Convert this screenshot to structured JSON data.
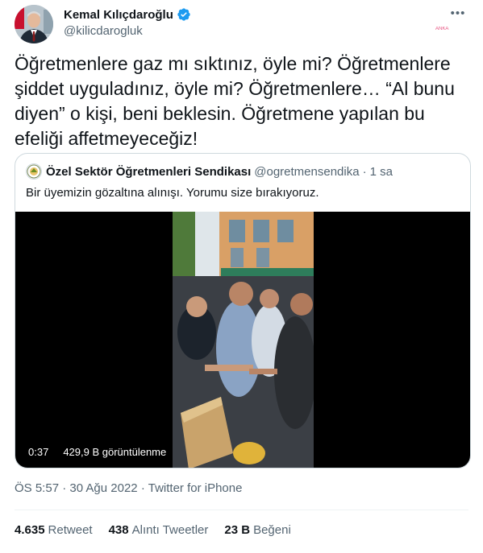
{
  "author": {
    "display_name": "Kemal Kılıçdaroğlu",
    "handle": "@kilicdarogluk",
    "verified_color": "#1d9bf0"
  },
  "more_icon": "more-dots-icon",
  "watermark": "ANKA",
  "tweet_text": "Öğretmenlere gaz mı sıktınız, öyle mi? Öğretmenlere şiddet uyguladınız, öyle mi? Öğretmenlere… “Al bunu diyen” o kişi, beni beklesin. Öğretmene yapılan bu efeliği affetmeyeceğiz!",
  "quoted_tweet": {
    "display_name": "Özel Sektör Öğretmenleri Sendikası",
    "handle": "@ogretmensendika",
    "separator": "·",
    "time": "1 sa",
    "text": "Bir üyemizin gözaltına alınışı. Yorumu size bırakıyoruz.",
    "video": {
      "duration": "0:37",
      "views": "429,9 B görüntülenme"
    }
  },
  "meta": {
    "time": "ÖS 5:57",
    "date": "30 Ağu 2022",
    "source": "Twitter for iPhone",
    "separator": "·"
  },
  "stats": {
    "retweets_count": "4.635",
    "retweets_label": "Retweet",
    "quotes_count": "438",
    "quotes_label": "Alıntı Tweetler",
    "likes_count": "23 B",
    "likes_label": "Beğeni"
  }
}
